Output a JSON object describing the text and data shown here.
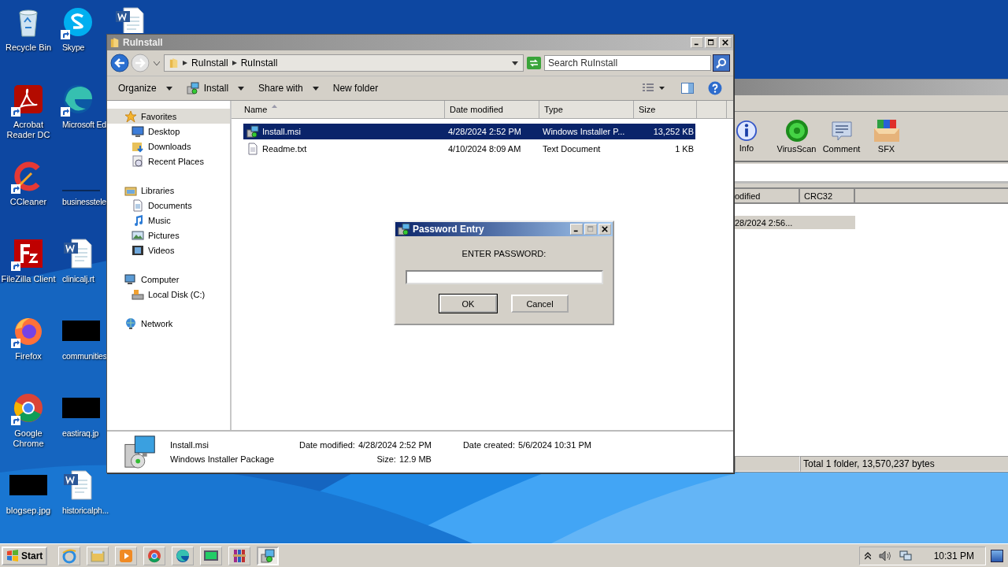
{
  "desktop_icons": [
    {
      "label": "Recycle Bin",
      "kind": "recycle",
      "shortcut": false
    },
    {
      "label": "Acrobat Reader DC",
      "kind": "acrobat",
      "shortcut": true
    },
    {
      "label": "CCleaner",
      "kind": "ccleaner",
      "shortcut": true
    },
    {
      "label": "FileZilla Client",
      "kind": "filezilla",
      "shortcut": true
    },
    {
      "label": "Firefox",
      "kind": "firefox",
      "shortcut": true
    },
    {
      "label": "Google Chrome",
      "kind": "chrome",
      "shortcut": true
    },
    {
      "label": "blogsep.jpg",
      "kind": "dark",
      "shortcut": false
    },
    {
      "label": "Skype",
      "kind": "skype",
      "shortcut": true
    },
    {
      "label": "Microsoft Ed",
      "kind": "edge",
      "shortcut": true
    },
    {
      "label": "businesstele",
      "kind": "line",
      "shortcut": false
    },
    {
      "label": "clinicalj.rt",
      "kind": "word",
      "shortcut": false
    },
    {
      "label": "communities",
      "kind": "dark",
      "shortcut": false
    },
    {
      "label": "eastiraq.jp",
      "kind": "dark",
      "shortcut": false
    },
    {
      "label": "historicalph...",
      "kind": "word",
      "shortcut": false
    },
    {
      "kind": "word",
      "shortcut": false
    }
  ],
  "winrar": {
    "toolbar": [
      {
        "label": "Info",
        "kind": "info"
      },
      {
        "label": "VirusScan",
        "kind": "scan"
      },
      {
        "label": "Comment",
        "kind": "comment"
      },
      {
        "label": "SFX",
        "kind": "sfx"
      }
    ],
    "columns": [
      "odified",
      "CRC32"
    ],
    "rows": [
      {
        "cells": [
          "28/2024 2:56...",
          ""
        ],
        "selected": true
      }
    ],
    "status": "Total 1 folder, 13,570,237 bytes"
  },
  "explorer": {
    "title": "RuInstall",
    "breadcrumb": [
      "RuInstall",
      "RuInstall"
    ],
    "search": {
      "placeholder": "Search RuInstall"
    },
    "toolbar": [
      {
        "label": "Organize",
        "dropdown": true,
        "kind": "text"
      },
      {
        "label": "Install",
        "dropdown": true,
        "kind": "install"
      },
      {
        "label": "Share with",
        "dropdown": true,
        "kind": "text"
      },
      {
        "label": "New folder",
        "dropdown": false,
        "kind": "text"
      }
    ],
    "nav": [
      {
        "label": "Favorites",
        "kind": "star",
        "selected": true,
        "children": [
          {
            "label": "Desktop",
            "kind": "desktop",
            "selected": false
          },
          {
            "label": "Downloads",
            "kind": "downloads",
            "selected": false
          },
          {
            "label": "Recent Places",
            "kind": "recent",
            "selected": false
          }
        ]
      },
      {
        "label": "Libraries",
        "kind": "library",
        "selected": false,
        "children": [
          {
            "label": "Documents",
            "kind": "doc",
            "selected": false
          },
          {
            "label": "Music",
            "kind": "music",
            "selected": false
          },
          {
            "label": "Pictures",
            "kind": "pictures",
            "selected": false
          },
          {
            "label": "Videos",
            "kind": "videos",
            "selected": false
          }
        ]
      },
      {
        "label": "Computer",
        "kind": "computer",
        "selected": false,
        "children": [
          {
            "label": "Local Disk (C:)",
            "kind": "disk",
            "selected": false
          }
        ]
      },
      {
        "label": "Network",
        "kind": "network",
        "selected": false
      }
    ],
    "columns": [
      "Name",
      "Date modified",
      "Type",
      "Size"
    ],
    "rows": [
      {
        "kind": "msi",
        "name": "Install.msi",
        "date": "4/28/2024 2:52 PM",
        "type": "Windows Installer P...",
        "size": "13,252 KB",
        "selected": true
      },
      {
        "kind": "txt",
        "name": "Readme.txt",
        "date": "4/10/2024 8:09 AM",
        "type": "Text Document",
        "size": "1 KB",
        "selected": false
      }
    ],
    "details": {
      "name": "Install.msi",
      "type": "Windows Installer Package",
      "fields": [
        {
          "label": "Date modified:",
          "value": "4/28/2024 2:52 PM"
        },
        {
          "label": "Size:",
          "value": "12.9 MB"
        },
        {
          "label": "Date created:",
          "value": "5/6/2024 10:31 PM"
        }
      ]
    }
  },
  "dialog": {
    "title": "Password Entry",
    "prompt": "ENTER PASSWORD:",
    "buttons": [
      {
        "label": "OK",
        "default": true
      },
      {
        "label": "Cancel",
        "default": false
      }
    ]
  },
  "taskbar": {
    "start": "Start",
    "apps": [
      {
        "kind": "ie",
        "active": false
      },
      {
        "kind": "folder",
        "active": false
      },
      {
        "kind": "media",
        "active": false
      },
      {
        "kind": "chrome",
        "active": false
      },
      {
        "kind": "edge",
        "active": false
      },
      {
        "kind": "monitor",
        "active": false
      },
      {
        "kind": "winrar",
        "active": false
      },
      {
        "kind": "installer",
        "active": true
      }
    ],
    "clock": "10:31 PM"
  }
}
